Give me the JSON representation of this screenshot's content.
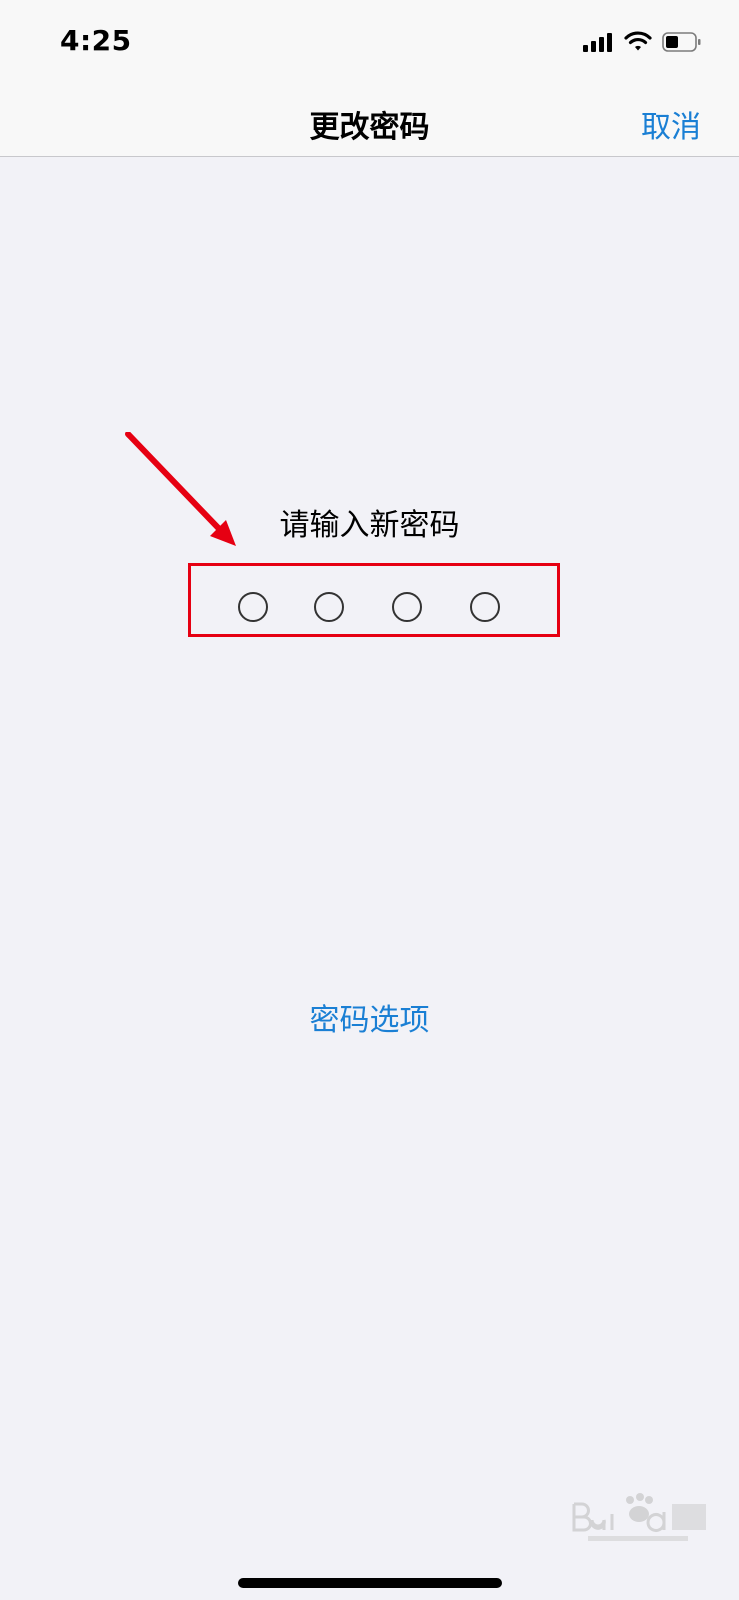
{
  "status_bar": {
    "time": "4:25",
    "icons": [
      "signal-icon",
      "wifi-icon",
      "battery-icon"
    ]
  },
  "nav": {
    "title": "更改密码",
    "cancel_label": "取消"
  },
  "passcode": {
    "prompt": "请输入新密码",
    "digits_total": 4,
    "digits_entered": 0
  },
  "options_label": "密码选项",
  "colors": {
    "accent": "#1a7fd4",
    "annotation_red": "#e60012",
    "background": "#f2f2f7"
  }
}
